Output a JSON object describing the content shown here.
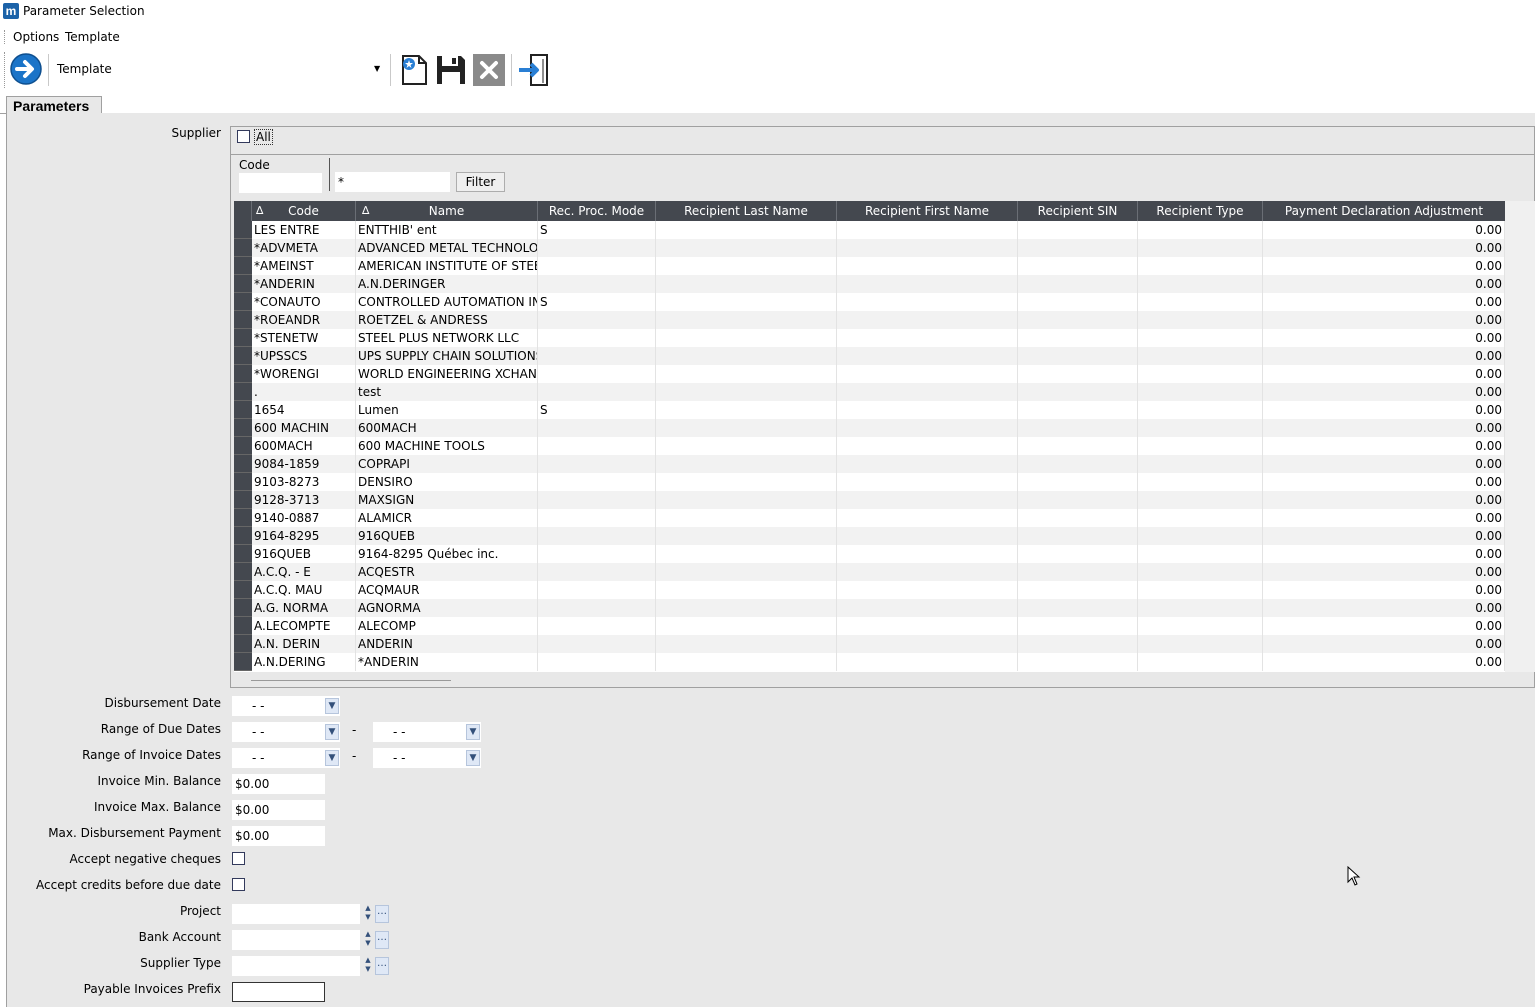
{
  "window": {
    "title": "Parameter Selection",
    "app_icon": "m"
  },
  "menu": {
    "items": [
      "Options",
      "Template"
    ]
  },
  "toolbar": {
    "template_label": "Template"
  },
  "tabs": {
    "active": "Parameters"
  },
  "supplier": {
    "label": "Supplier",
    "all_label": "All",
    "all_checked": false,
    "filter": {
      "code_label": "Code",
      "code_value": "",
      "pattern_value": "*",
      "button": "Filter"
    },
    "columns": [
      "Code",
      "Name",
      "Rec. Proc. Mode",
      "Recipient Last Name",
      "Recipient First Name",
      "Recipient SIN",
      "Recipient Type",
      "Payment Declaration Adjustment"
    ],
    "rows": [
      [
        " LES ENTRE",
        "ENTTHIB' ent",
        "S",
        "",
        "",
        "",
        "",
        "0.00"
      ],
      [
        "*ADVMETA",
        "ADVANCED METAL TECHNOLOGY",
        "",
        "",
        "",
        "",
        "",
        "0.00"
      ],
      [
        "*AMEINST",
        "AMERICAN INSTITUTE OF STEEL",
        "",
        "",
        "",
        "",
        "",
        "0.00"
      ],
      [
        "*ANDERIN",
        "A.N.DERINGER",
        "",
        "",
        "",
        "",
        "",
        "0.00"
      ],
      [
        "*CONAUTO",
        "CONTROLLED AUTOMATION INC",
        "S",
        "",
        "",
        "",
        "",
        "0.00"
      ],
      [
        "*ROEANDR",
        "ROETZEL & ANDRESS",
        "",
        "",
        "",
        "",
        "",
        "0.00"
      ],
      [
        "*STENETW",
        "STEEL PLUS NETWORK LLC",
        "",
        "",
        "",
        "",
        "",
        "0.00"
      ],
      [
        "*UPSSCS",
        "UPS SUPPLY CHAIN SOLUTIONS",
        "",
        "",
        "",
        "",
        "",
        "0.00"
      ],
      [
        "*WORENGI",
        "WORLD ENGINEERING XCHANGE",
        "",
        "",
        "",
        "",
        "",
        "0.00"
      ],
      [
        ".",
        "test",
        "",
        "",
        "",
        "",
        "",
        "0.00"
      ],
      [
        "1654",
        "Lumen",
        "S",
        "",
        "",
        "",
        "",
        "0.00"
      ],
      [
        "600 MACHIN",
        "600MACH",
        "",
        "",
        "",
        "",
        "",
        "0.00"
      ],
      [
        "600MACH",
        "600 MACHINE TOOLS",
        "",
        "",
        "",
        "",
        "",
        "0.00"
      ],
      [
        "9084-1859",
        "COPRAPI",
        "",
        "",
        "",
        "",
        "",
        "0.00"
      ],
      [
        "9103-8273",
        "DENSIRO",
        "",
        "",
        "",
        "",
        "",
        "0.00"
      ],
      [
        "9128-3713",
        "MAXSIGN",
        "",
        "",
        "",
        "",
        "",
        "0.00"
      ],
      [
        "9140-0887",
        "ALAMICR",
        "",
        "",
        "",
        "",
        "",
        "0.00"
      ],
      [
        "9164-8295",
        "916QUEB",
        "",
        "",
        "",
        "",
        "",
        "0.00"
      ],
      [
        "916QUEB",
        "9164-8295 Québec inc.",
        "",
        "",
        "",
        "",
        "",
        "0.00"
      ],
      [
        "A.C.Q. - E",
        "ACQESTR",
        "",
        "",
        "",
        "",
        "",
        "0.00"
      ],
      [
        "A.C.Q. MAU",
        "ACQMAUR",
        "",
        "",
        "",
        "",
        "",
        "0.00"
      ],
      [
        "A.G. NORMA",
        "AGNORMA",
        "",
        "",
        "",
        "",
        "",
        "0.00"
      ],
      [
        "A.LECOMPTE",
        "ALECOMP",
        "",
        "",
        "",
        "",
        "",
        "0.00"
      ],
      [
        "A.N. DERIN",
        "ANDERIN",
        "",
        "",
        "",
        "",
        "",
        "0.00"
      ],
      [
        "A.N.DERING",
        "*ANDERIN",
        "",
        "",
        "",
        "",
        "",
        "0.00"
      ]
    ]
  },
  "params": {
    "disbursement_date": {
      "label": "Disbursement Date",
      "value": "- -"
    },
    "due_dates": {
      "label": "Range of Due Dates",
      "from": "- -",
      "to": "- -",
      "sep": "-"
    },
    "invoice_dates": {
      "label": "Range of Invoice Dates",
      "from": "- -",
      "to": "- -",
      "sep": "-"
    },
    "inv_min": {
      "label": "Invoice Min. Balance",
      "value": "$0.00"
    },
    "inv_max": {
      "label": "Invoice Max. Balance",
      "value": "$0.00"
    },
    "max_disb": {
      "label": "Max. Disbursement Payment",
      "value": "$0.00"
    },
    "neg_cheques": {
      "label": "Accept negative cheques",
      "checked": false
    },
    "credits_before_due": {
      "label": "Accept credits before due date",
      "checked": false
    },
    "project": {
      "label": "Project",
      "value": ""
    },
    "bank_account": {
      "label": "Bank Account",
      "value": ""
    },
    "supplier_type": {
      "label": "Supplier Type",
      "value": ""
    },
    "payable_prefix": {
      "label": "Payable Invoices Prefix",
      "value": ""
    }
  },
  "colors": {
    "grid_header": "#44484f",
    "panel_bg": "#e8e8e8",
    "accent_blue": "#1b62a8"
  }
}
